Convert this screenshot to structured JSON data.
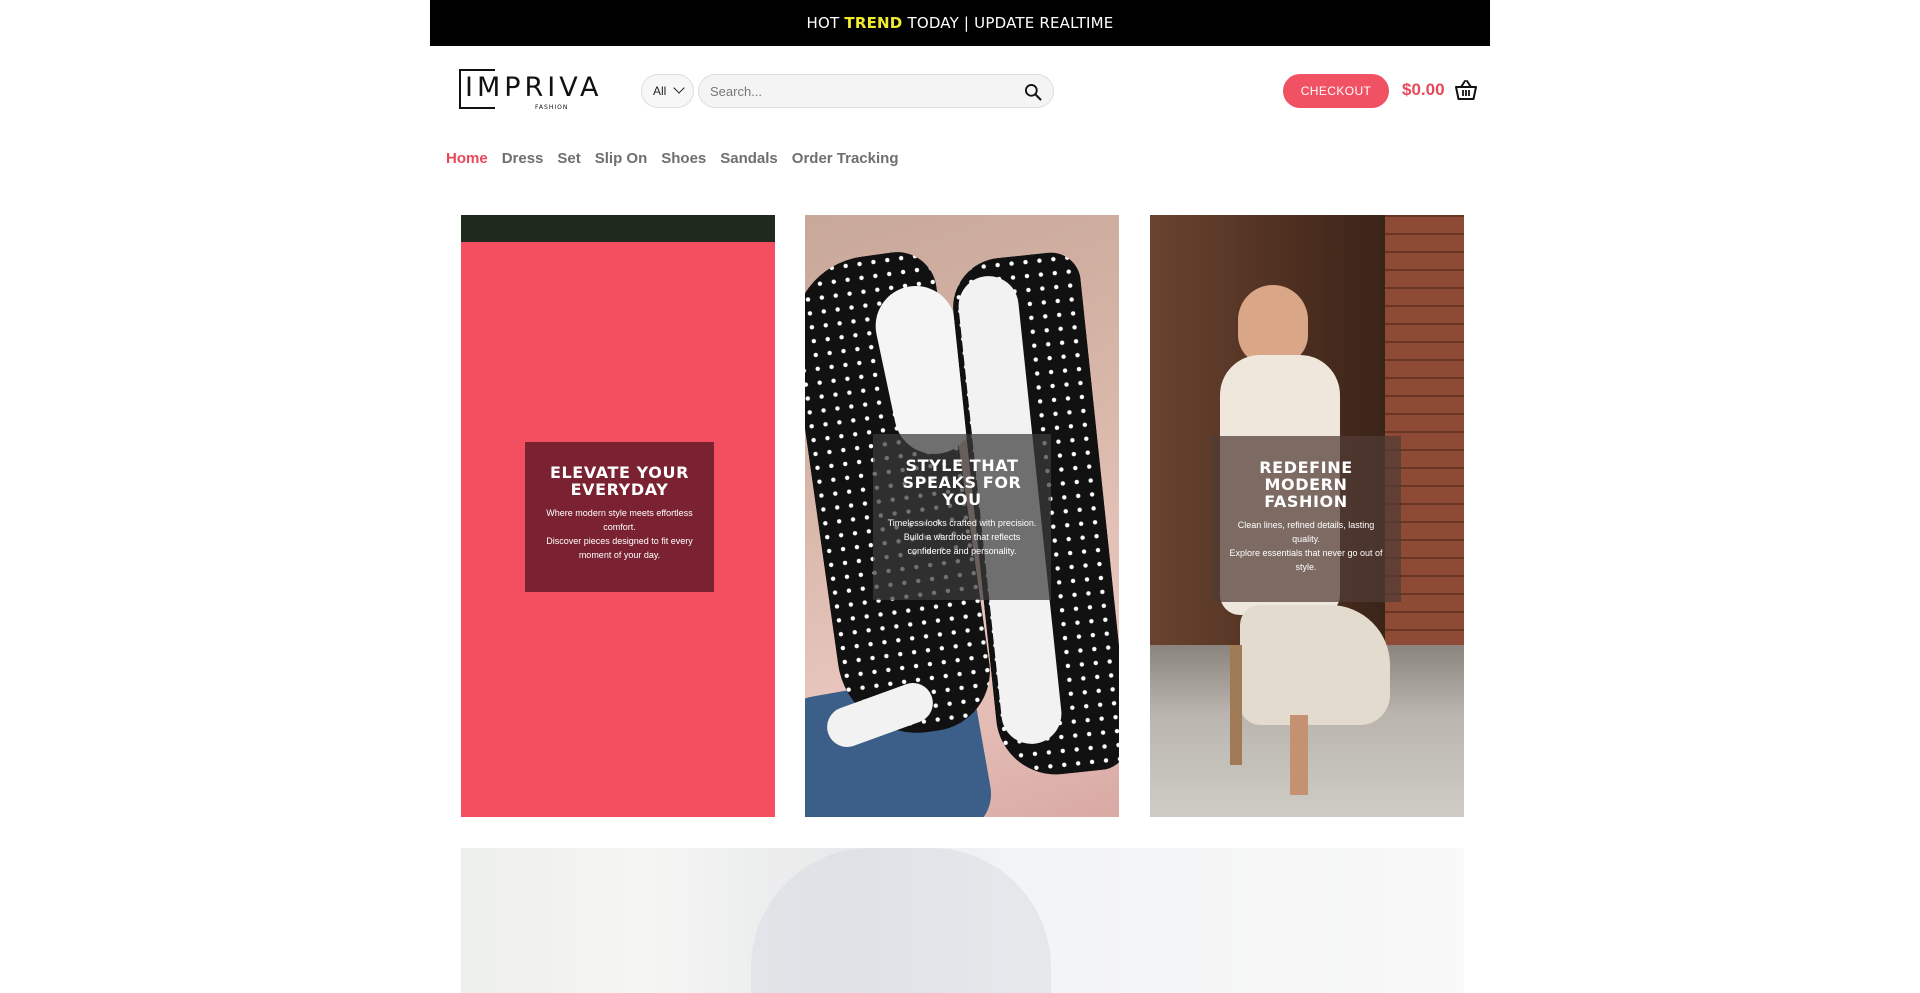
{
  "topbar": {
    "pre": "HOT",
    "highlight": "TREND",
    "post": "TODAY | UPDATE REALTIME"
  },
  "header": {
    "logo_text": "IMPRIVA",
    "logo_sub": "FASHION",
    "category_select": "All",
    "search_placeholder": "Search...",
    "checkout_label": "CHECKOUT",
    "cart_total": "$0.00"
  },
  "nav": {
    "items": [
      {
        "label": "Home",
        "active": true
      },
      {
        "label": "Dress"
      },
      {
        "label": "Set"
      },
      {
        "label": "Slip On"
      },
      {
        "label": "Shoes"
      },
      {
        "label": "Sandals"
      },
      {
        "label": "Order Tracking"
      }
    ]
  },
  "banners": [
    {
      "title": "ELEVATE YOUR EVERYDAY",
      "line1": "Where modern style meets effortless comfort.",
      "line2": "Discover pieces designed to fit every moment of your day."
    },
    {
      "title": "STYLE THAT SPEAKS FOR YOU",
      "line1": "Timeless looks crafted with precision.",
      "line2": "Build a wardrobe that reflects confidence and personality."
    },
    {
      "title": "REDEFINE MODERN FASHION",
      "line1": "Clean lines, refined details, lasting quality.",
      "line2": "Explore essentials that never go out of style."
    }
  ],
  "colors": {
    "accent": "#e8485a",
    "checkout_bg": "#f05163",
    "banner1_bg": "#f34f61",
    "topbar_highlight": "#f2ea2e"
  },
  "icons": {
    "search": "search-icon",
    "cart": "basket-icon",
    "chevron": "chevron-down-icon"
  }
}
